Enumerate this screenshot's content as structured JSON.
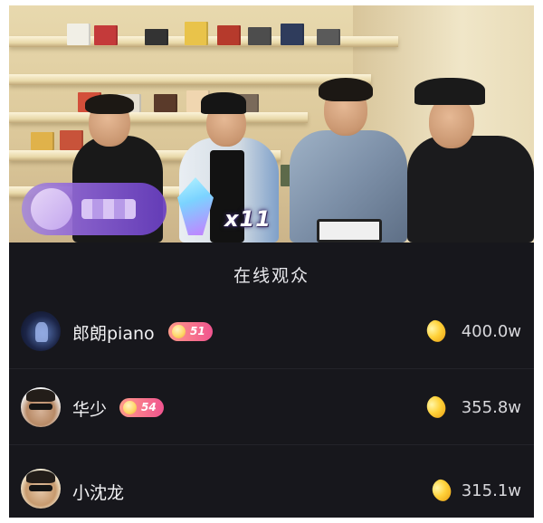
{
  "video": {
    "gift_combo": "x11"
  },
  "audience": {
    "title": "在线观众",
    "viewers": [
      {
        "name": "郎朗piano",
        "level": "51",
        "value": "400.0w",
        "avatar": "starry-stage-avatar"
      },
      {
        "name": "华少",
        "level": "54",
        "value": "355.8w",
        "avatar": "man-glasses-avatar"
      },
      {
        "name": "小沈龙",
        "level": "",
        "value": "315.1w",
        "avatar": "man-sunglasses-avatar"
      }
    ]
  },
  "colors": {
    "panel_bg": "#17171c",
    "level_badge": "#f0548f",
    "bean_icon": "#ffd23a"
  }
}
